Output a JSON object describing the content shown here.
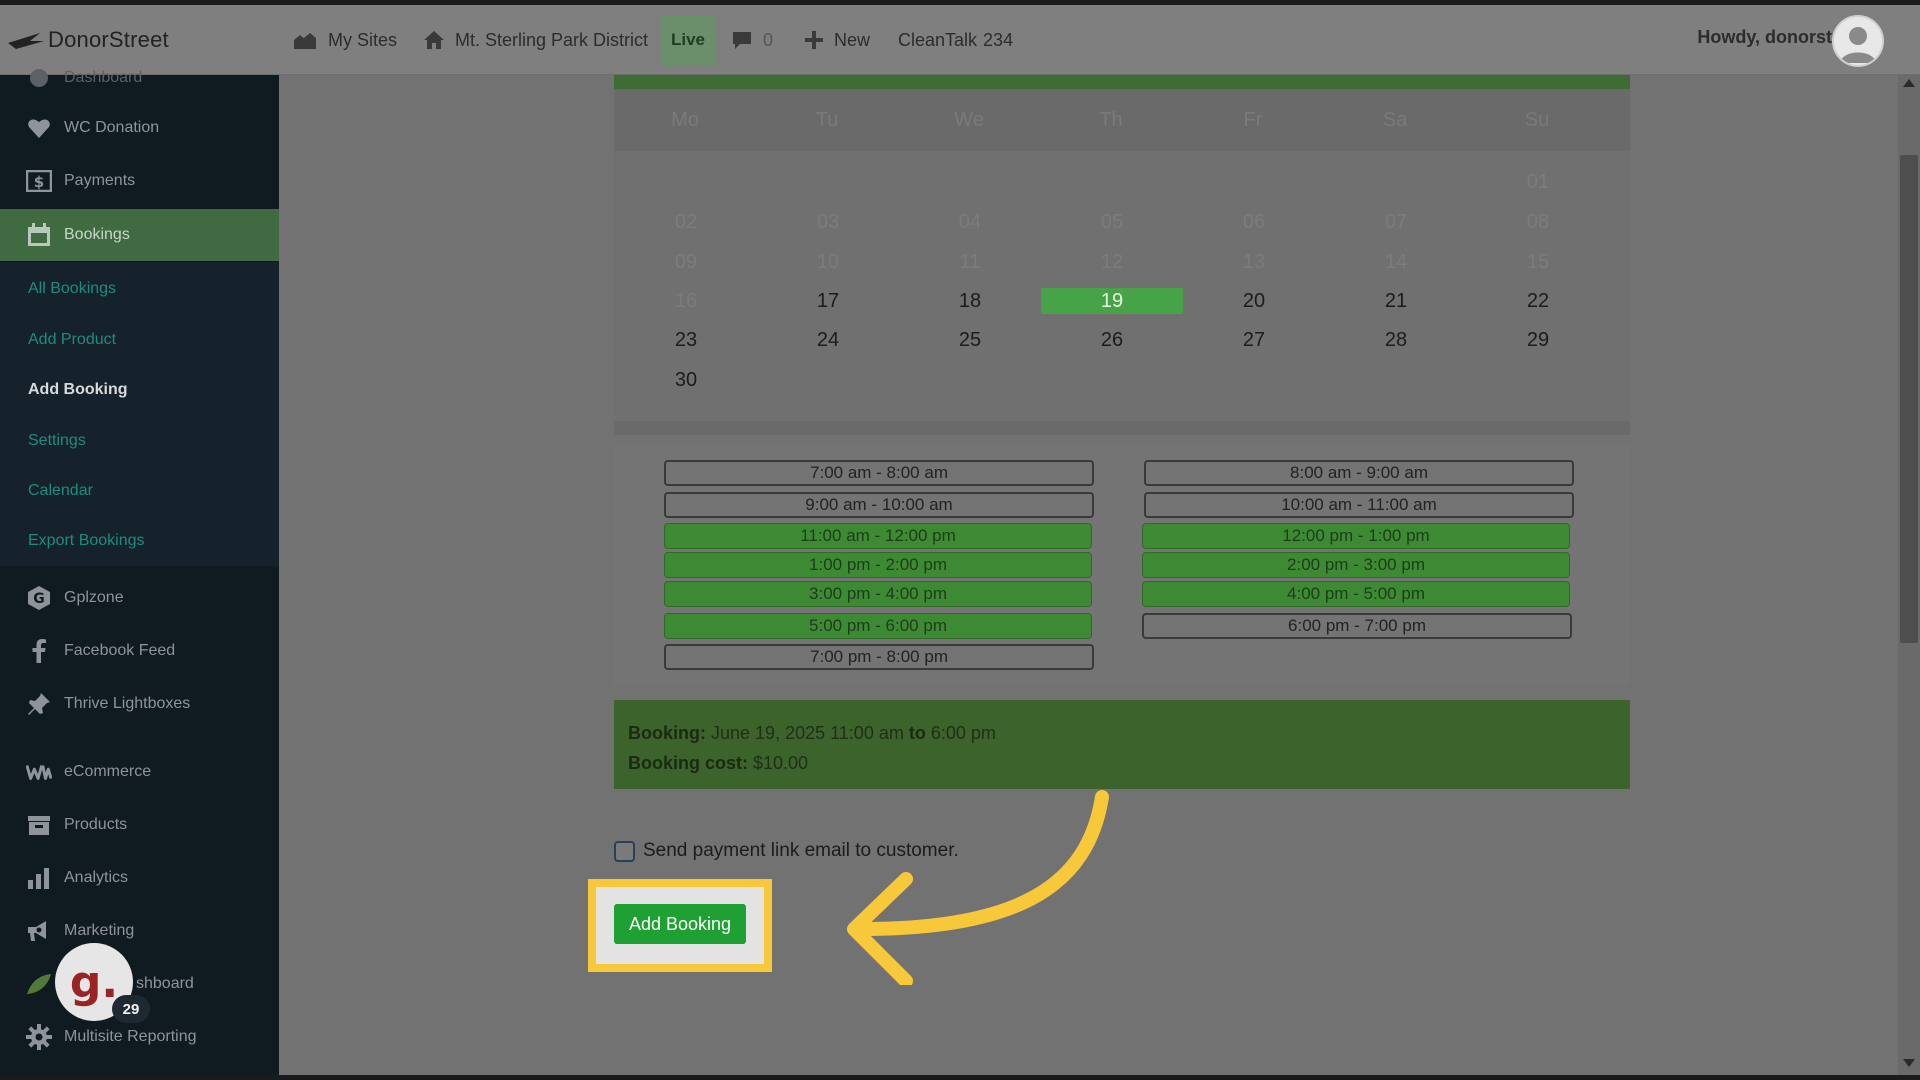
{
  "topbar": {
    "brand": "DonorStreet",
    "my_sites": "My Sites",
    "site_name": "Mt. Sterling Park District",
    "live": "Live",
    "comments_count": "0",
    "new_label": "New",
    "cleantalk": "CleanTalk",
    "cleantalk_count": "234",
    "howdy": "Howdy, donorst"
  },
  "sidebar": {
    "items": [
      {
        "label": "Dashboard",
        "icon": "dashboard-icon"
      },
      {
        "label": "WC Donation",
        "icon": "heart-icon"
      },
      {
        "label": "Payments",
        "icon": "dollar-icon"
      },
      {
        "label": "Bookings",
        "icon": "calendar-icon"
      },
      {
        "label": "Gplzone",
        "icon": "g-icon"
      },
      {
        "label": "Facebook Feed",
        "icon": "facebook-icon"
      },
      {
        "label": "Thrive Lightboxes",
        "icon": "pin-icon"
      },
      {
        "label": "eCommerce",
        "icon": "woo-icon"
      },
      {
        "label": "Products",
        "icon": "box-icon"
      },
      {
        "label": "Analytics",
        "icon": "bar-chart-icon"
      },
      {
        "label": "Marketing",
        "icon": "megaphone-icon"
      },
      {
        "label": "shboard",
        "icon": "leaf-icon"
      },
      {
        "label": "Multisite Reporting",
        "icon": "gear-icon"
      }
    ],
    "submenu": [
      "All Bookings",
      "Add Product",
      "Add Booking",
      "Settings",
      "Calendar",
      "Export Bookings"
    ],
    "gravatar_letter": "g.",
    "gravatar_badge": "29"
  },
  "calendar": {
    "weekdays": [
      "Mo",
      "Tu",
      "We",
      "Th",
      "Fr",
      "Sa",
      "Su"
    ],
    "rows": [
      [
        "",
        "",
        "",
        "",
        "",
        "",
        "01"
      ],
      [
        "02",
        "03",
        "04",
        "05",
        "06",
        "07",
        "08"
      ],
      [
        "09",
        "10",
        "11",
        "12",
        "13",
        "14",
        "15"
      ],
      [
        "16",
        "17",
        "18",
        "19",
        "20",
        "21",
        "22"
      ],
      [
        "23",
        "24",
        "25",
        "26",
        "27",
        "28",
        "29"
      ],
      [
        "30",
        "",
        "",
        "",
        "",
        "",
        ""
      ]
    ],
    "selected_day": "19"
  },
  "slots": [
    {
      "label": "7:00 am - 8:00 am",
      "chosen": false
    },
    {
      "label": "8:00 am - 9:00 am",
      "chosen": false
    },
    {
      "label": "9:00 am - 10:00 am",
      "chosen": false
    },
    {
      "label": "10:00 am - 11:00 am",
      "chosen": false
    },
    {
      "label": "11:00 am - 12:00 pm",
      "chosen": true
    },
    {
      "label": "12:00 pm - 1:00 pm",
      "chosen": true
    },
    {
      "label": "1:00 pm - 2:00 pm",
      "chosen": true
    },
    {
      "label": "2:00 pm - 3:00 pm",
      "chosen": true
    },
    {
      "label": "3:00 pm - 4:00 pm",
      "chosen": true
    },
    {
      "label": "4:00 pm - 5:00 pm",
      "chosen": true
    },
    {
      "label": "5:00 pm - 6:00 pm",
      "chosen": true
    },
    {
      "label": "6:00 pm - 7:00 pm",
      "chosen": false
    },
    {
      "label": "7:00 pm - 8:00 pm",
      "chosen": false
    }
  ],
  "summary": {
    "booking_label": "Booking:",
    "booking_date": "June 19, 2025 11:00 am",
    "to_label": "to",
    "booking_end": "6:00 pm",
    "cost_label": "Booking cost:",
    "cost_value": "$10.00"
  },
  "form": {
    "email_label": "Send payment link email to customer.",
    "email_checked": false,
    "submit_label": "Add Booking"
  },
  "colors": {
    "accent_green": "#1fa032",
    "highlight_yellow": "#f7c93a",
    "sidebar_bg": "#101a21"
  }
}
